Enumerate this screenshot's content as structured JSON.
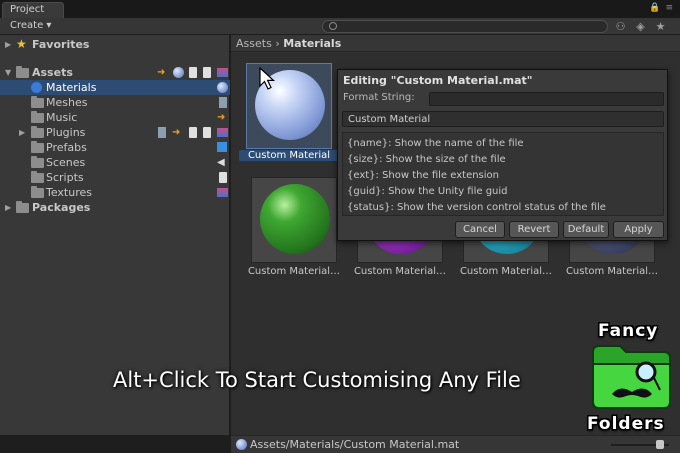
{
  "window": {
    "tab_title": "Project"
  },
  "toolbar": {
    "create_label": "Create ▾",
    "search_placeholder": ""
  },
  "sidebar": {
    "favorites": "Favorites",
    "assets": "Assets",
    "items": [
      {
        "label": "Materials"
      },
      {
        "label": "Meshes"
      },
      {
        "label": "Music"
      },
      {
        "label": "Plugins"
      },
      {
        "label": "Prefabs"
      },
      {
        "label": "Scenes"
      },
      {
        "label": "Scripts"
      },
      {
        "label": "Textures"
      }
    ],
    "packages": "Packages"
  },
  "breadcrumb": {
    "root": "Assets",
    "separator": "›",
    "current": "Materials"
  },
  "tiles": [
    {
      "label": "Custom Material",
      "color": "#9fb4e8"
    },
    {
      "label": "Custom Material…",
      "color": "#2f8a2a"
    },
    {
      "label": "Custom Material…",
      "color": "#a030c0"
    },
    {
      "label": "Custom Material…",
      "color": "#28b0c8"
    },
    {
      "label": "Custom Material…",
      "color": "#4a5070"
    }
  ],
  "popup": {
    "title": "Editing \"Custom Material.mat\"",
    "format_label": "Format String:",
    "format_value": "",
    "name_value": "Custom Material",
    "help": [
      "{name}: Show the name of the file",
      "{size}: Show the size of the file",
      "{ext}: Show the file extension",
      "{guid}: Show the Unity file guid",
      "{status}: Show the version control status of the file"
    ],
    "buttons": {
      "cancel": "Cancel",
      "revert": "Revert",
      "default": "Default",
      "apply": "Apply"
    }
  },
  "overlay": {
    "tagline": "Alt+Click To Start Customising Any File",
    "logo_top": "Fancy",
    "logo_bottom": "Folders"
  },
  "status": {
    "path": "Assets/Materials/Custom Material.mat",
    "zoom_slider": 0.85
  },
  "colors": {
    "selection": "#2c4c74",
    "accent_green": "#3fd43a"
  }
}
